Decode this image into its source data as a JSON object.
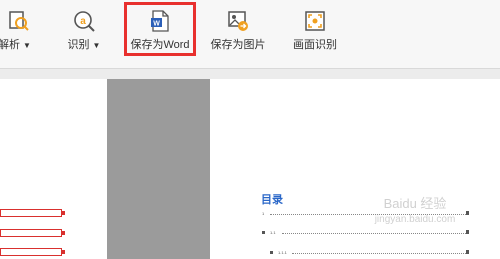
{
  "toolbar": {
    "items": [
      {
        "label": "解析",
        "icon": "parse-icon",
        "has_dropdown": true
      },
      {
        "label": "识别",
        "icon": "recognize-icon",
        "has_dropdown": true
      },
      {
        "label": "保存为Word",
        "icon": "word-document-icon",
        "highlighted": true
      },
      {
        "label": "保存为图片",
        "icon": "image-export-icon"
      },
      {
        "label": "画面识别",
        "icon": "screen-recognize-icon"
      }
    ],
    "dropdown_glyph": "▼"
  },
  "document": {
    "toc_title": "目录",
    "toc_entries": [
      "1",
      "1.1",
      "1.1.1"
    ]
  },
  "watermark": {
    "text_line1": "Baidu 经验",
    "text_line2": "jingyan.baidu.com"
  },
  "colors": {
    "highlight": "#e8302e",
    "toc_title": "#2a67c8",
    "accent": "#f0a020"
  }
}
